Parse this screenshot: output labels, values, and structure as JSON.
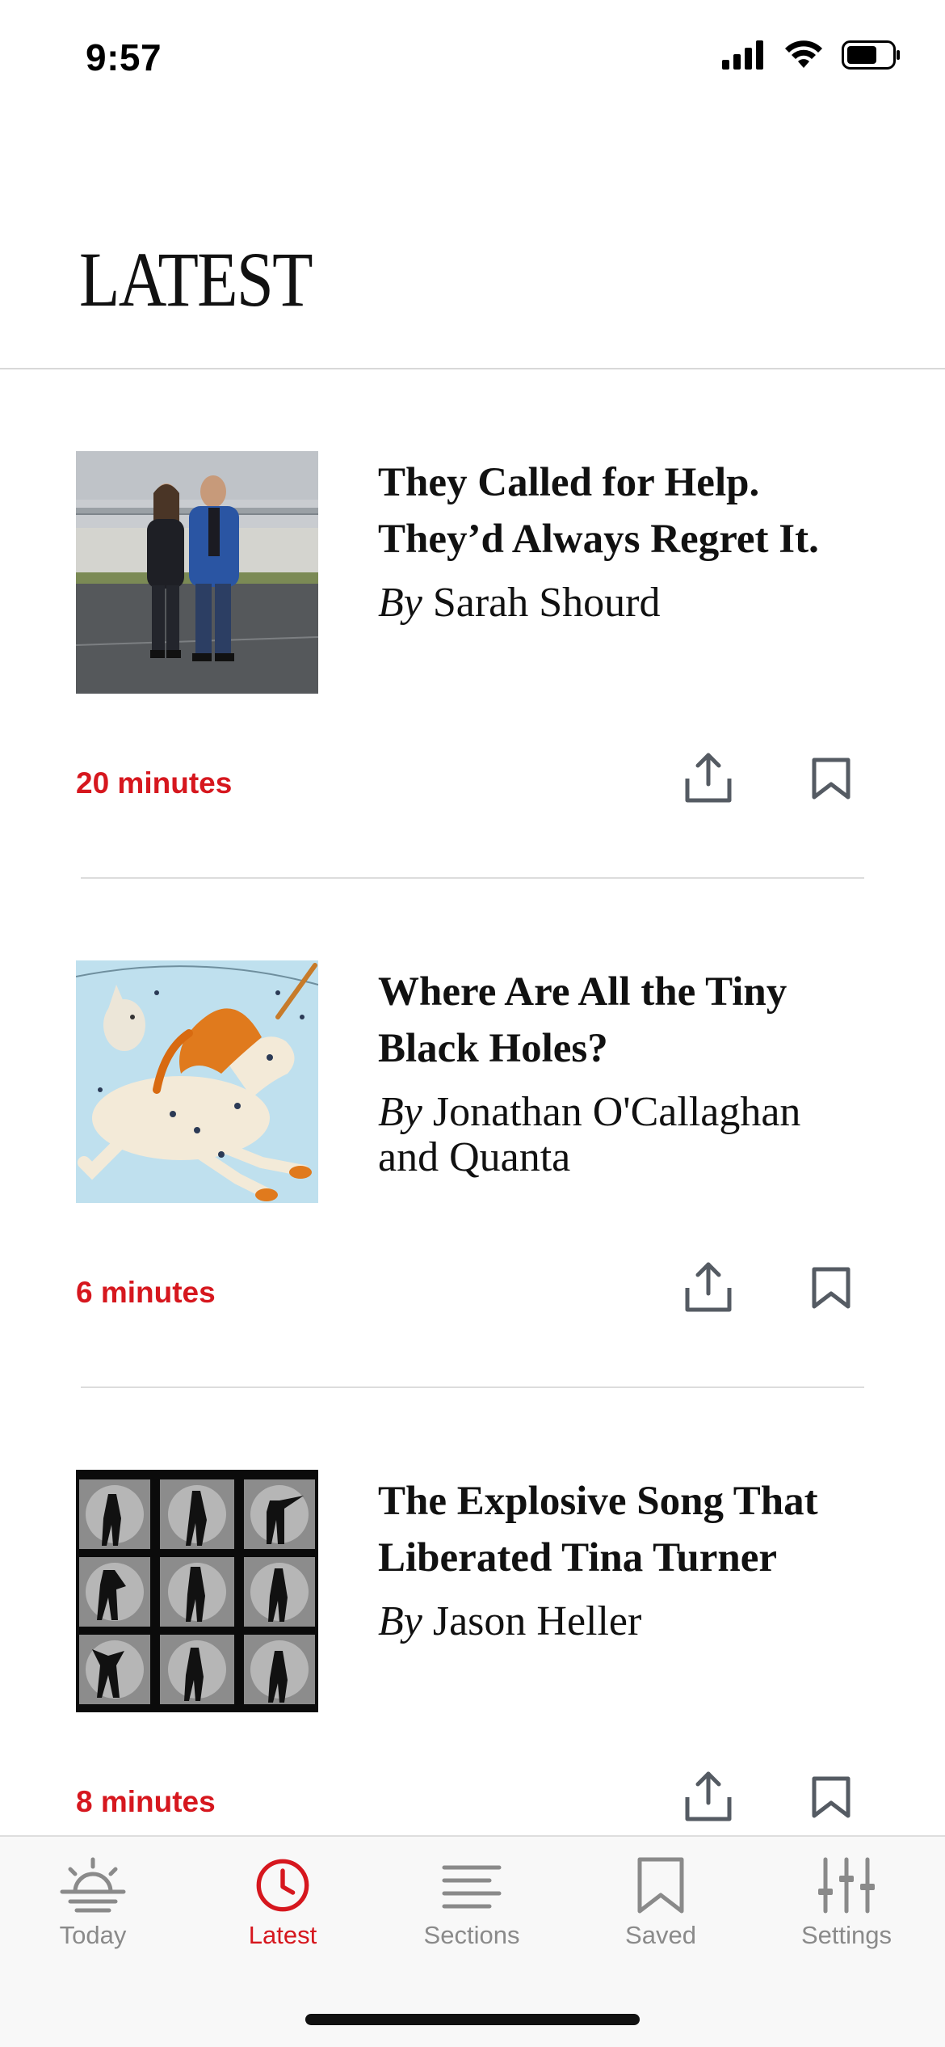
{
  "status": {
    "time": "9:57"
  },
  "header": {
    "title": "LATEST"
  },
  "articles": [
    {
      "headline_line1": "They Called for Help.",
      "headline_line2": "They’d Always Regret It.",
      "by": "By",
      "author": " Sarah Shourd",
      "author_line2": "",
      "read_time": "20 minutes",
      "thumb_icon": "photo-two-people-prison"
    },
    {
      "headline_line1": "Where Are All the Tiny",
      "headline_line2": "Black Holes?",
      "by": "By",
      "author": " Jonathan O'Callaghan",
      "author_line2": "and Quanta",
      "read_time": "6 minutes",
      "thumb_icon": "illustration-unicorn-constellation"
    },
    {
      "headline_line1": "The Explosive Song That",
      "headline_line2": "Liberated Tina Turner",
      "by": "By",
      "author": " Jason Heller",
      "author_line2": "",
      "read_time": "8 minutes",
      "thumb_icon": "photo-contact-sheet"
    }
  ],
  "tabs": [
    {
      "label": "Today",
      "icon": "sunrise-icon",
      "active": false
    },
    {
      "label": "Latest",
      "icon": "clock-icon",
      "active": true
    },
    {
      "label": "Sections",
      "icon": "lines-icon",
      "active": false
    },
    {
      "label": "Saved",
      "icon": "bookmark-icon",
      "active": false
    },
    {
      "label": "Settings",
      "icon": "sliders-icon",
      "active": false
    }
  ],
  "colors": {
    "accent": "#d6171e",
    "inactive": "#8a8a8a",
    "icon_gray": "#5a5a5a"
  }
}
